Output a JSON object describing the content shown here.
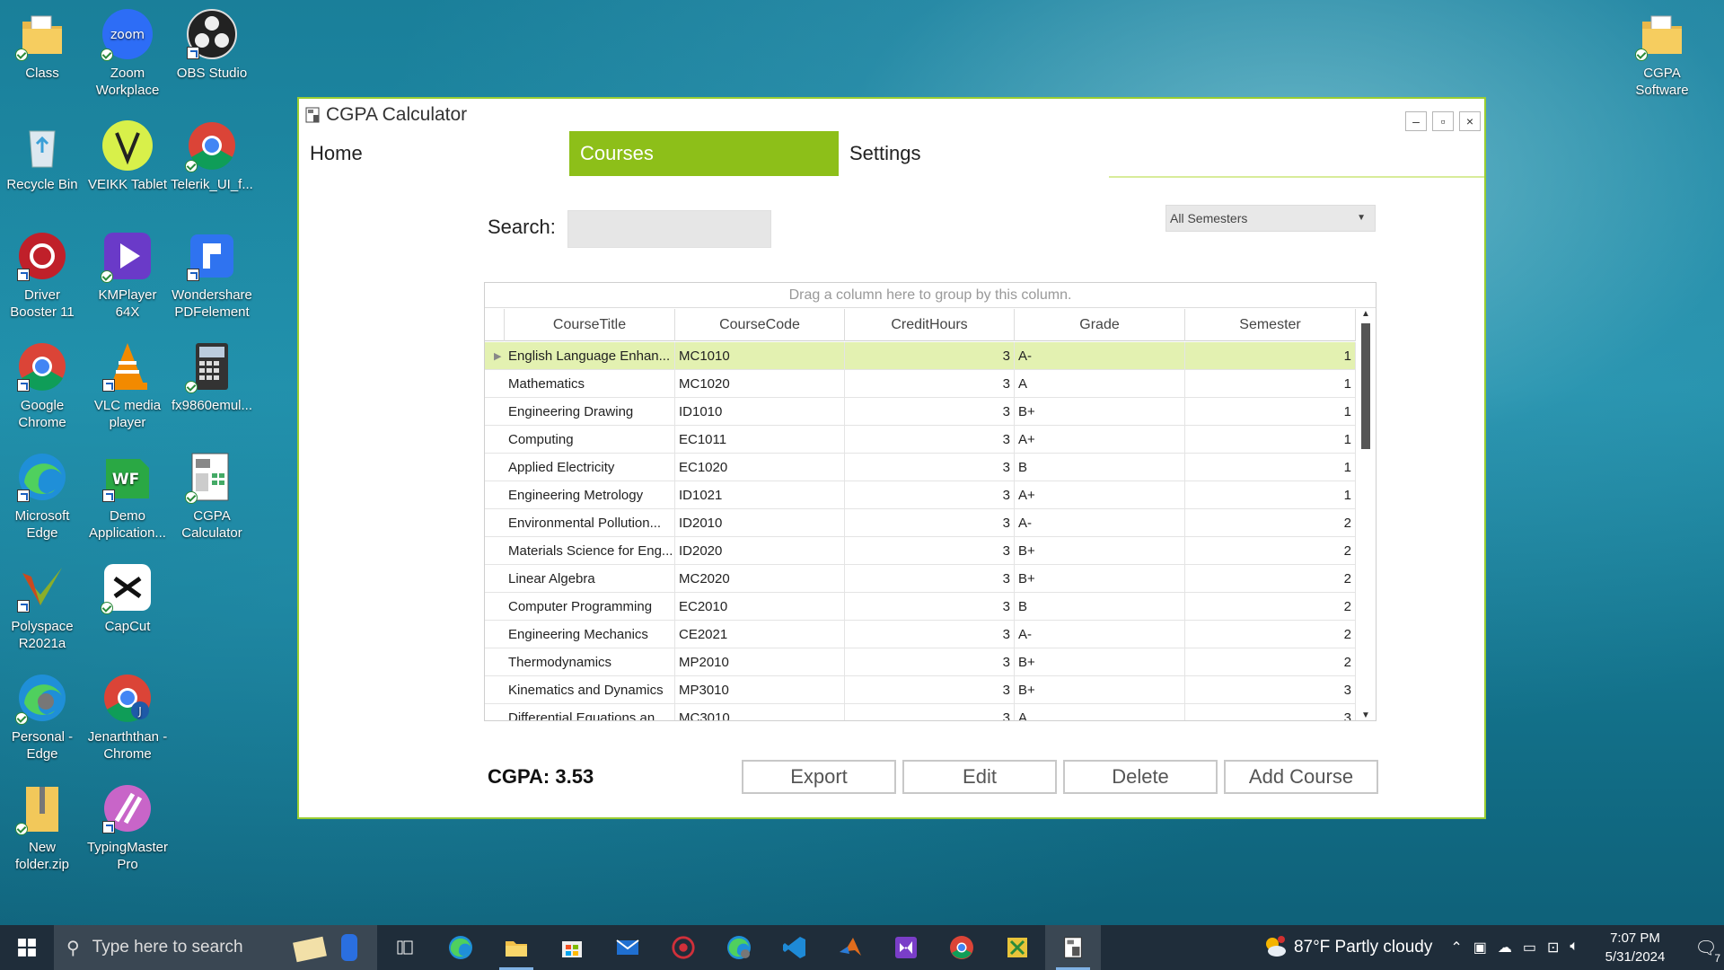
{
  "desktop": {
    "icons": [
      {
        "label": "Class"
      },
      {
        "label": "Zoom Workplace"
      },
      {
        "label": "OBS Studio"
      },
      {
        "label": "Recycle Bin"
      },
      {
        "label": "VEIKK Tablet"
      },
      {
        "label": "Telerik_UI_f..."
      },
      {
        "label": "Driver Booster 11"
      },
      {
        "label": "KMPlayer 64X"
      },
      {
        "label": "Wondershare PDFelement"
      },
      {
        "label": "Google Chrome"
      },
      {
        "label": "VLC media player"
      },
      {
        "label": "fx9860emul..."
      },
      {
        "label": "Microsoft Edge"
      },
      {
        "label": "Demo Application..."
      },
      {
        "label": "CGPA Calculator"
      },
      {
        "label": "Polyspace R2021a"
      },
      {
        "label": "CapCut"
      },
      {
        "label": "Personal - Edge"
      },
      {
        "label": "Jenarththan - Chrome"
      },
      {
        "label": "New folder.zip"
      },
      {
        "label": "TypingMaster Pro"
      },
      {
        "label": "CGPA Software"
      }
    ]
  },
  "window": {
    "title": "CGPA Calculator",
    "controls": {
      "minimize": "–",
      "maximize": "▫",
      "close": "×"
    },
    "tabs": [
      {
        "label": "Home"
      },
      {
        "label": "Courses"
      },
      {
        "label": "Settings"
      }
    ],
    "active_tab": "Courses",
    "search": {
      "label": "Search:",
      "value": ""
    },
    "semester_filter": {
      "selected": "All Semesters"
    },
    "grid": {
      "group_panel_text": "Drag a column here to group by this column.",
      "columns": [
        "CourseTitle",
        "CourseCode",
        "CreditHours",
        "Grade",
        "Semester"
      ],
      "rows": [
        {
          "title": "English Language Enhan...",
          "code": "MC1010",
          "credits": "3",
          "grade": "A-",
          "semester": "1"
        },
        {
          "title": "Mathematics",
          "code": "MC1020",
          "credits": "3",
          "grade": "A",
          "semester": "1"
        },
        {
          "title": "Engineering Drawing",
          "code": "ID1010",
          "credits": "3",
          "grade": "B+",
          "semester": "1"
        },
        {
          "title": "Computing",
          "code": "EC1011",
          "credits": "3",
          "grade": "A+",
          "semester": "1"
        },
        {
          "title": "Applied Electricity",
          "code": "EC1020",
          "credits": "3",
          "grade": "B",
          "semester": "1"
        },
        {
          "title": "Engineering Metrology",
          "code": "ID1021",
          "credits": "3",
          "grade": "A+",
          "semester": "1"
        },
        {
          "title": "Environmental Pollution...",
          "code": "ID2010",
          "credits": "3",
          "grade": "A-",
          "semester": "2"
        },
        {
          "title": "Materials Science for Eng...",
          "code": "ID2020",
          "credits": "3",
          "grade": "B+",
          "semester": "2"
        },
        {
          "title": "Linear Algebra",
          "code": "MC2020",
          "credits": "3",
          "grade": "B+",
          "semester": "2"
        },
        {
          "title": "Computer Programming",
          "code": "EC2010",
          "credits": "3",
          "grade": "B",
          "semester": "2"
        },
        {
          "title": "Engineering Mechanics",
          "code": "CE2021",
          "credits": "3",
          "grade": "A-",
          "semester": "2"
        },
        {
          "title": "Thermodynamics",
          "code": "MP2010",
          "credits": "3",
          "grade": "B+",
          "semester": "2"
        },
        {
          "title": "Kinematics and Dynamics",
          "code": "MP3010",
          "credits": "3",
          "grade": "B+",
          "semester": "3"
        },
        {
          "title": "Differential Equations an...",
          "code": "MC3010",
          "credits": "3",
          "grade": "A",
          "semester": "3"
        }
      ],
      "selected_row": 0
    },
    "cgpa_text": "CGPA: 3.53",
    "buttons": {
      "export": "Export",
      "edit": "Edit",
      "delete": "Delete",
      "add": "Add Course"
    }
  },
  "taskbar": {
    "search_placeholder": "Type here to search",
    "weather": "87°F  Partly cloudy",
    "time": "7:07 PM",
    "date": "5/31/2024",
    "notification_count": "7"
  },
  "colors": {
    "accent": "#8dbf19",
    "selected_row": "#e3f1b1",
    "taskbar": "#1f2d3a"
  }
}
